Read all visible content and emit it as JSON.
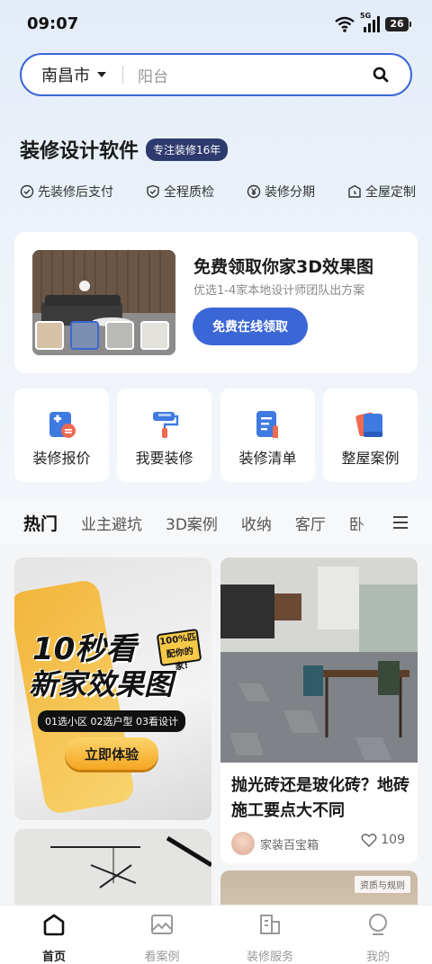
{
  "status_bar": {
    "time": "09:07",
    "network": "5G",
    "battery": "26"
  },
  "search": {
    "city": "南昌市",
    "placeholder": "阳台"
  },
  "brand": {
    "title": "装修设计软件",
    "badge": "专注装修16年"
  },
  "features": [
    "先装修后支付",
    "全程质检",
    "装修分期",
    "全屋定制"
  ],
  "promo": {
    "title": "免费领取你家3D效果图",
    "subtitle": "优选1-4家本地设计师团队出方案",
    "button": "免费在线领取"
  },
  "quick_actions": [
    {
      "label": "装修报价",
      "icon": "calculator-icon"
    },
    {
      "label": "我要装修",
      "icon": "paint-roller-icon"
    },
    {
      "label": "装修清单",
      "icon": "checklist-icon"
    },
    {
      "label": "整屋案例",
      "icon": "cases-icon"
    }
  ],
  "tabs": [
    "热门",
    "业主避坑",
    "3D案例",
    "收纳",
    "客厅",
    "卧"
  ],
  "feed": {
    "ad": {
      "line1": "10秒看",
      "line2": "新家效果图",
      "stamp": "100%匹配你的家!",
      "steps": "01选小区 02选户型 03看设计",
      "button": "立即体验"
    },
    "article": {
      "title": "抛光砖还是玻化砖？地砖施工要点大不同",
      "author": "家装百宝箱",
      "likes": "109"
    },
    "rules_tag": "资质与规则"
  },
  "bottom_nav": [
    {
      "label": "首页",
      "icon": "home-icon",
      "active": true
    },
    {
      "label": "看案例",
      "icon": "image-icon",
      "active": false
    },
    {
      "label": "装修服务",
      "icon": "building-icon",
      "active": false
    },
    {
      "label": "我的",
      "icon": "profile-icon",
      "active": false
    }
  ],
  "colors": {
    "accent": "#3b66d6",
    "badge_bg": "#2d3a6e",
    "cta_gold": "#f5a623"
  }
}
